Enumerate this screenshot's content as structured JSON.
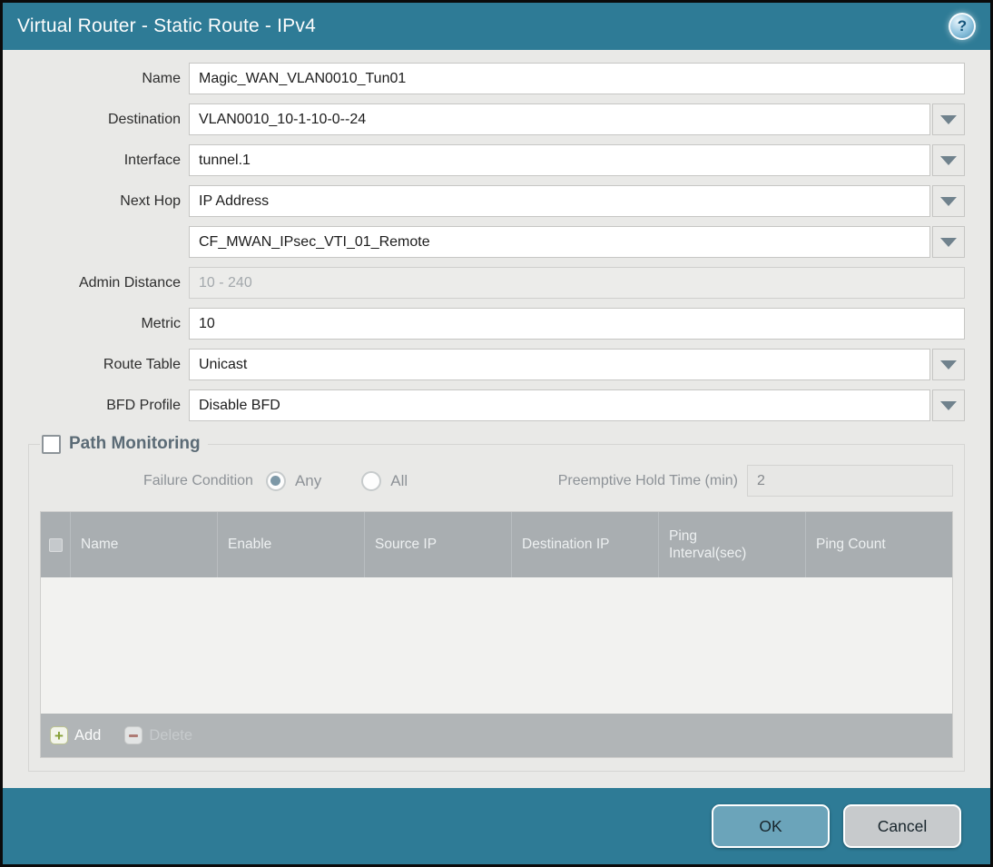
{
  "titlebar": {
    "title": "Virtual Router - Static Route - IPv4"
  },
  "form": {
    "name": {
      "label": "Name",
      "value": "Magic_WAN_VLAN0010_Tun01"
    },
    "destination": {
      "label": "Destination",
      "value": "VLAN0010_10-1-10-0--24"
    },
    "interface": {
      "label": "Interface",
      "value": "tunnel.1"
    },
    "next_hop": {
      "label": "Next Hop",
      "value": "IP Address"
    },
    "next_hop_address": {
      "value": "CF_MWAN_IPsec_VTI_01_Remote"
    },
    "admin_distance": {
      "label": "Admin Distance",
      "placeholder": "10 - 240"
    },
    "metric": {
      "label": "Metric",
      "value": "10"
    },
    "route_table": {
      "label": "Route Table",
      "value": "Unicast"
    },
    "bfd_profile": {
      "label": "BFD Profile",
      "value": "Disable BFD"
    }
  },
  "path_monitoring": {
    "title": "Path Monitoring",
    "enabled": false,
    "failure_condition": {
      "label": "Failure Condition",
      "any": "Any",
      "all": "All",
      "selected": "Any"
    },
    "preemptive_hold_time": {
      "label": "Preemptive Hold Time (min)",
      "value": "2"
    },
    "table": {
      "columns": [
        "Name",
        "Enable",
        "Source IP",
        "Destination IP",
        "Ping Interval(sec)",
        "Ping Count"
      ],
      "rows": []
    },
    "toolbar": {
      "add": "Add",
      "delete": "Delete"
    }
  },
  "footer": {
    "ok": "OK",
    "cancel": "Cancel"
  },
  "colors": {
    "titlebar": "#2e7b96",
    "ok_button": "#6ba4ba",
    "cancel_button": "#c7cacc",
    "table_header": "#a9aeb1",
    "table_footer": "#b1b5b7"
  }
}
